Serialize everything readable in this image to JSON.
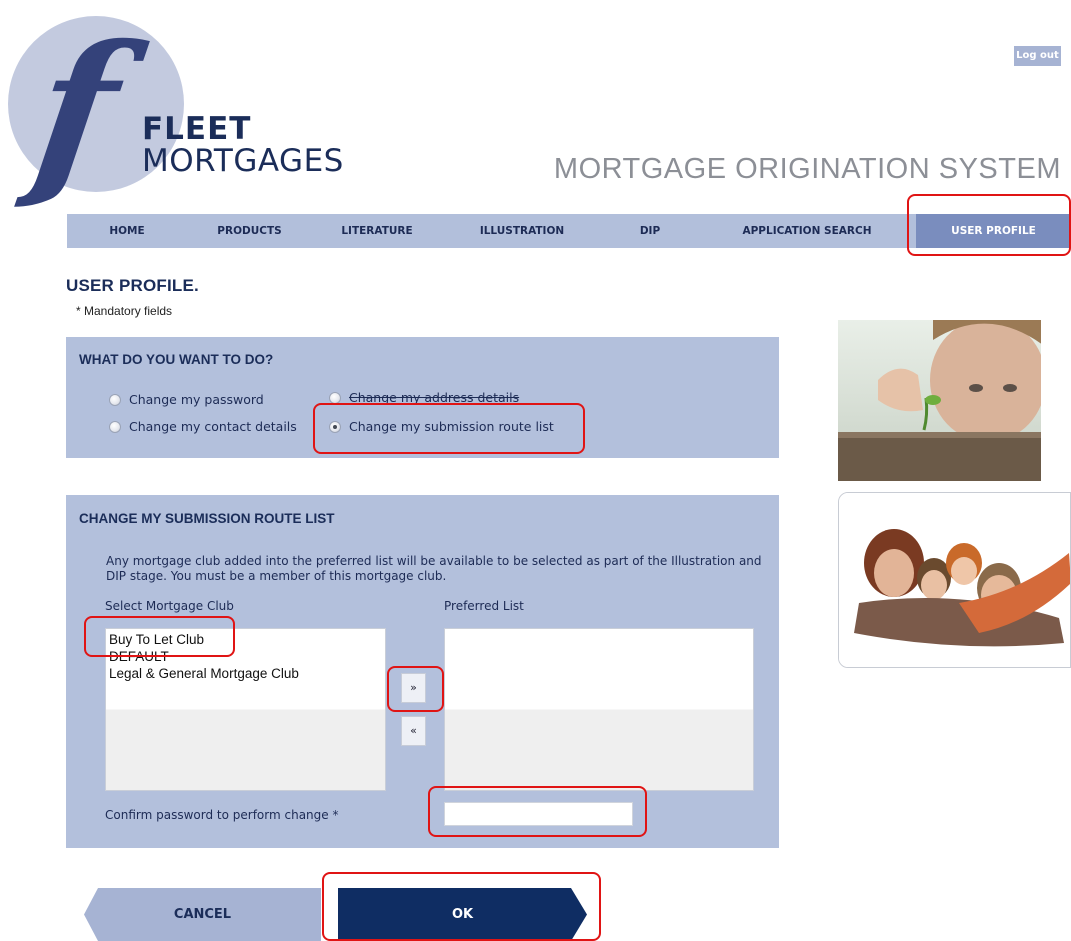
{
  "header": {
    "brand_line1": "FLEET",
    "brand_line2": "MORTGAGES",
    "system_title": "MORTGAGE ORIGINATION SYSTEM",
    "logout_label": "Log out",
    "logo_icon": "fleet-f-logo-icon"
  },
  "nav": {
    "items": [
      {
        "label": "HOME"
      },
      {
        "label": "PRODUCTS"
      },
      {
        "label": "LITERATURE"
      },
      {
        "label": "ILLUSTRATION"
      },
      {
        "label": "DIP"
      },
      {
        "label": "APPLICATION SEARCH"
      },
      {
        "label": "USER PROFILE",
        "active": true
      }
    ]
  },
  "page": {
    "title": "USER PROFILE.",
    "mandatory_note": "* Mandatory fields"
  },
  "action_panel": {
    "heading": "WHAT DO YOU WANT TO DO?",
    "options": [
      {
        "label": "Change my password",
        "checked": false
      },
      {
        "label": "Change my address details",
        "checked": false
      },
      {
        "label": "Change my contact details",
        "checked": false
      },
      {
        "label": "Change my submission route list",
        "checked": true
      }
    ]
  },
  "route_panel": {
    "heading": "CHANGE MY SUBMISSION ROUTE LIST",
    "description": "Any mortgage club added into the preferred list will be available to be selected as part of the Illustration and DIP stage. You must be a member of this mortgage club.",
    "select_label": "Select Mortgage Club",
    "preferred_label": "Preferred List",
    "clubs": [
      "Buy To Let Club",
      "DEFAULT",
      "Legal & General Mortgage Club"
    ],
    "preferred": [],
    "add_button": "»",
    "remove_button": "«",
    "confirm_label": "Confirm password to perform change *",
    "confirm_value": ""
  },
  "buttons": {
    "cancel": "CANCEL",
    "ok": "OK"
  },
  "images": {
    "seedling": "child-with-seedling-photo",
    "family": "family-photo"
  },
  "colors": {
    "brand_navy": "#1b2d59",
    "panel_bg": "#b3c0dc",
    "nav_bg": "#b2bfdb",
    "nav_active": "#7a8dbe",
    "ok_button": "#0f2d63",
    "cancel_button": "#a6b3d3",
    "highlight": "#e01414"
  }
}
